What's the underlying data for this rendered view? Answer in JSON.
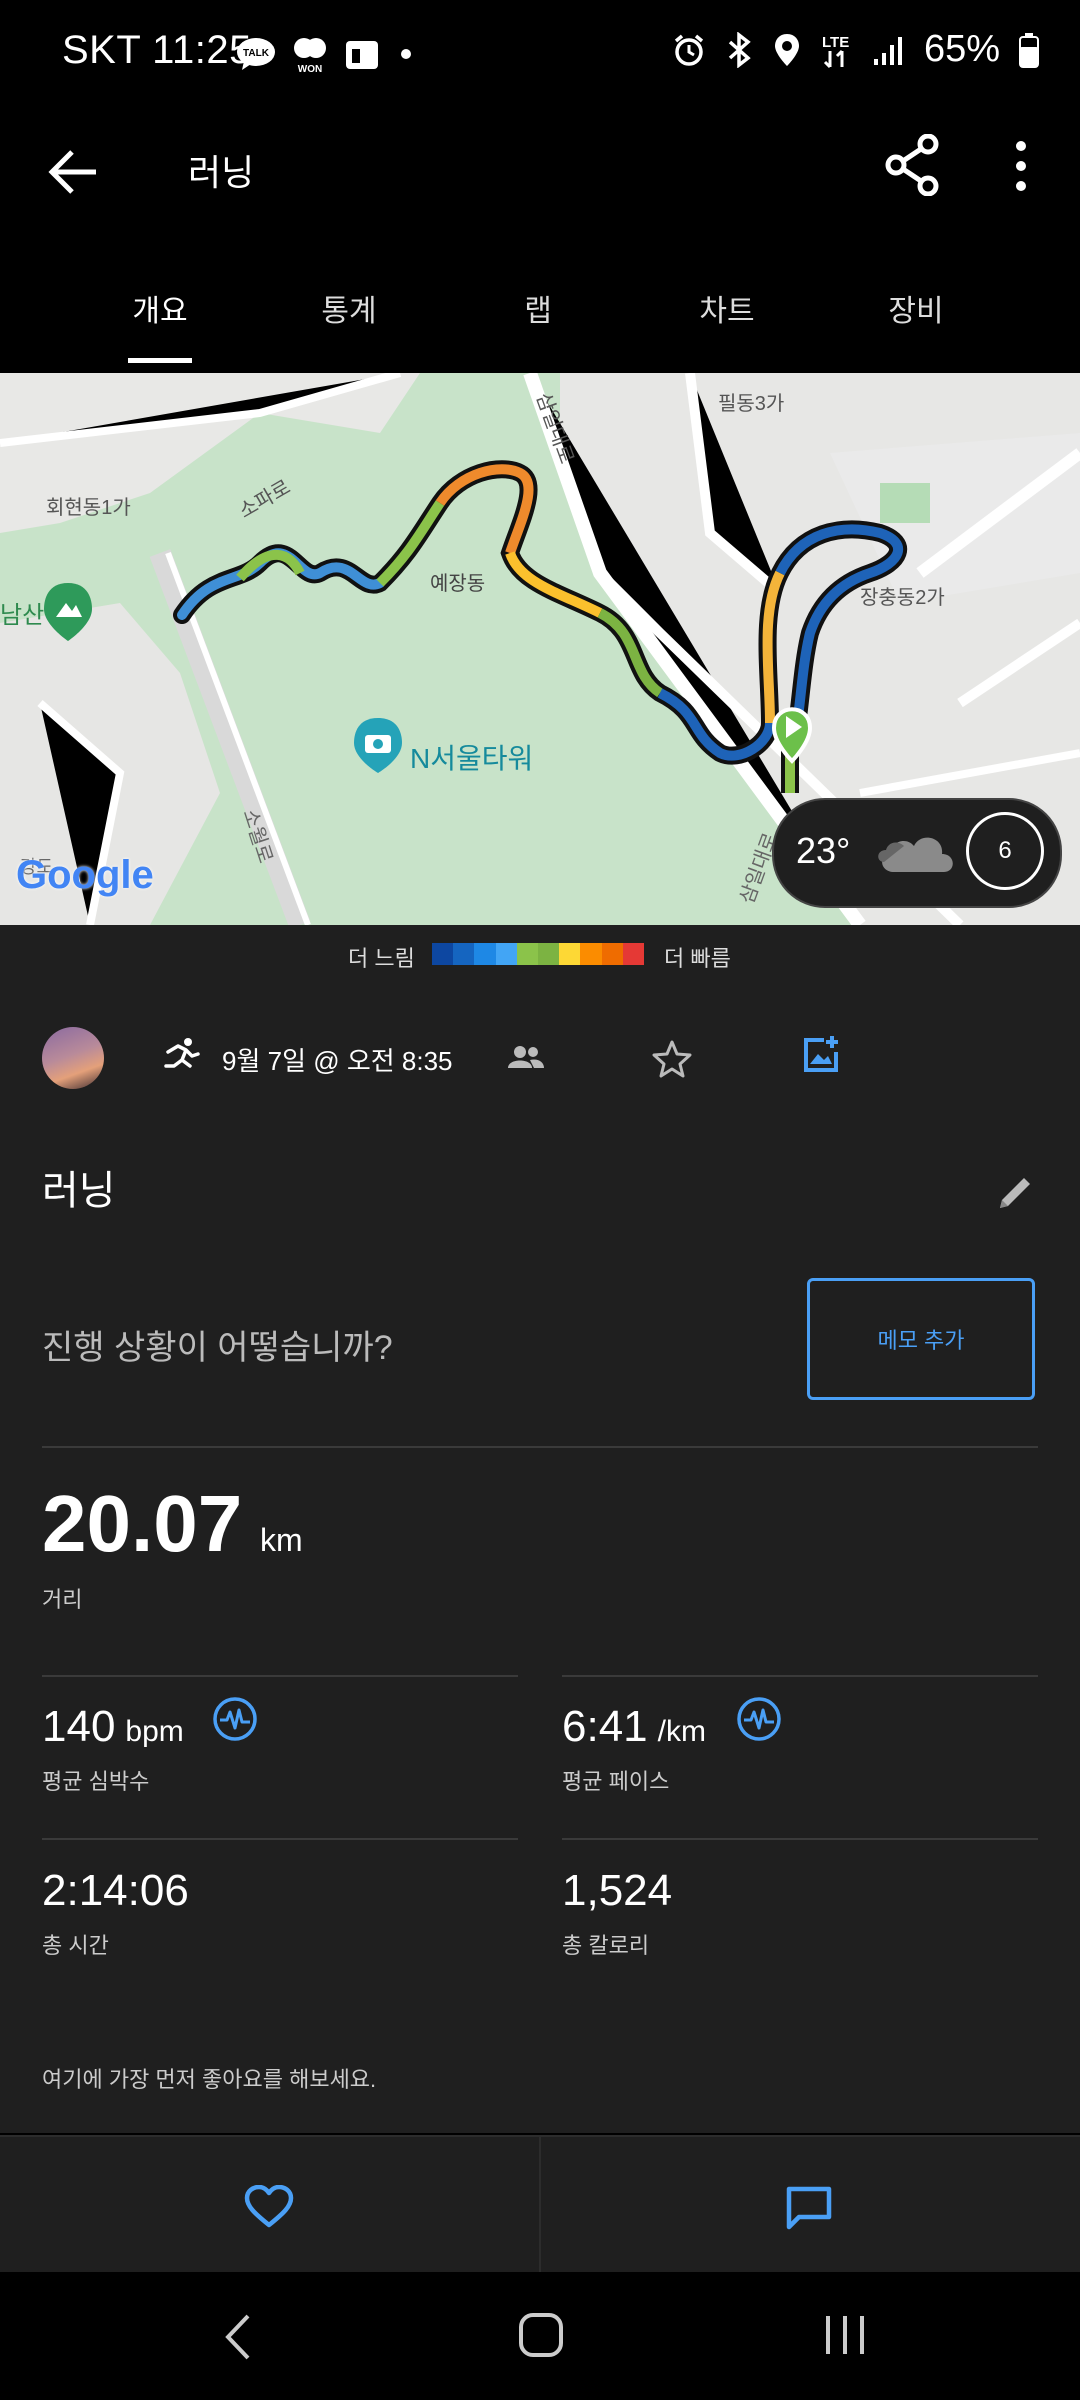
{
  "status_bar": {
    "carrier_time": "SKT 11:25",
    "battery": "65%",
    "icons": [
      "talk-icon",
      "won-icon",
      "calendar-icon",
      "dot-icon",
      "alarm-icon",
      "bluetooth-icon",
      "location-icon",
      "lte-icon",
      "signal-icon",
      "battery-icon"
    ]
  },
  "app_bar": {
    "title": "러닝",
    "back_icon": "arrow-left-icon",
    "share_icon": "share-icon",
    "more_icon": "more-vert-icon"
  },
  "tabs": [
    {
      "label": "개요",
      "selected": true
    },
    {
      "label": "통계",
      "selected": false
    },
    {
      "label": "랩",
      "selected": false
    },
    {
      "label": "차트",
      "selected": false
    },
    {
      "label": "장비",
      "selected": false
    }
  ],
  "map": {
    "labels": {
      "hoehyeon": "회현동1가",
      "sopa": "소파로",
      "yejang": "예장동",
      "samil": "삼일대로",
      "pildong": "필동3가",
      "jangchung": "장충동2가",
      "ntower": "N서울타워",
      "namsan": "남산",
      "sowol": "소월로",
      "samil2": "삼일대로",
      "gangdo": "강도"
    },
    "google": "Google",
    "weather": {
      "temp": "23°",
      "icon": "cloud-icon",
      "wind": "6"
    }
  },
  "legend": {
    "slow": "더 느림",
    "fast": "더 빠름",
    "colors": [
      "#0d47a1",
      "#1565c0",
      "#1e88e5",
      "#42a5f5",
      "#8bc34a",
      "#7cb342",
      "#fdd835",
      "#fb8c00",
      "#ef6c00",
      "#e53935"
    ]
  },
  "activity": {
    "datetime": "9월 7일 @ 오전 8:35",
    "title": "러닝",
    "question": "진행 상황이 어떻습니까?",
    "memo_button": "메모 추가",
    "distance": {
      "value": "20.07",
      "unit": "km",
      "label": "거리"
    },
    "heart_rate": {
      "value": "140",
      "unit": "bpm",
      "label": "평균 심박수"
    },
    "pace": {
      "value": "6:41",
      "unit": "/km",
      "label": "평균 페이스"
    },
    "total_time": {
      "value": "2:14:06",
      "label": "총 시간"
    },
    "calories": {
      "value": "1,524",
      "label": "총 칼로리"
    },
    "like_note": "여기에 가장 먼저 좋아요를 해보세요."
  },
  "accent_color": "#4a9ff5"
}
